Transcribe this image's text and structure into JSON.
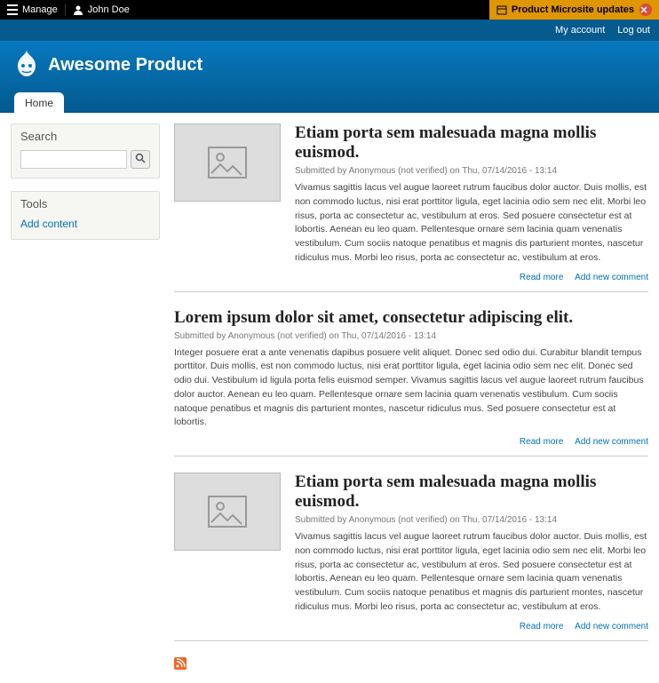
{
  "toolbar": {
    "manage_label": "Manage",
    "user_label": "John Doe",
    "updates_label": "Product Microsite updates"
  },
  "userbar": {
    "account": "My account",
    "logout": "Log out"
  },
  "site": {
    "name": "Awesome Product",
    "tabs": [
      "Home"
    ]
  },
  "sidebar": {
    "search_title": "Search",
    "search_placeholder": "",
    "tools_title": "Tools",
    "tools_links": [
      "Add content"
    ]
  },
  "links": {
    "read_more": "Read more",
    "add_comment": "Add new comment"
  },
  "articles": [
    {
      "has_image": true,
      "title": "Etiam porta sem malesuada magna mollis euismod.",
      "submitted": "Submitted by Anonymous (not verified) on Thu, 07/14/2016 - 13:14",
      "teaser": "Vivamus sagittis lacus vel augue laoreet rutrum faucibus dolor auctor. Duis mollis, est non commodo luctus, nisi erat porttitor ligula, eget lacinia odio sem nec elit. Morbi leo risus, porta ac consectetur ac, vestibulum at eros. Sed posuere consectetur est at lobortis. Aenean eu leo quam. Pellentesque ornare sem lacinia quam venenatis vestibulum. Cum sociis natoque penatibus et magnis dis parturient montes, nascetur ridiculus mus. Morbi leo risus, porta ac consectetur ac, vestibulum at eros."
    },
    {
      "has_image": false,
      "title": "Lorem ipsum dolor sit amet, consectetur adipiscing elit.",
      "submitted": "Submitted by Anonymous (not verified) on Thu, 07/14/2016 - 13:14",
      "teaser": "Integer posuere erat a ante venenatis dapibus posuere velit aliquet. Donec sed odio dui. Curabitur blandit tempus porttitor. Duis mollis, est non commodo luctus, nisi erat porttitor ligula, eget lacinia odio sem nec elit. Donec sed odio dui. Vestibulum id ligula porta felis euismod semper. Vivamus sagittis lacus vel augue laoreet rutrum faucibus dolor auctor. Aenean eu leo quam. Pellentesque ornare sem lacinia quam venenatis vestibulum. Cum sociis natoque penatibus et magnis dis parturient montes, nascetur ridiculus mus. Sed posuere consectetur est at lobortis."
    },
    {
      "has_image": true,
      "title": "Etiam porta sem malesuada magna mollis euismod.",
      "submitted": "Submitted by Anonymous (not verified) on Thu, 07/14/2016 - 13:14",
      "teaser": "Vivamus sagittis lacus vel augue laoreet rutrum faucibus dolor auctor. Duis mollis, est non commodo luctus, nisi erat porttitor ligula, eget lacinia odio sem nec elit. Morbi leo risus, porta ac consectetur ac, vestibulum at eros. Sed posuere consectetur est at lobortis. Aenean eu leo quam. Pellentesque ornare sem lacinia quam venenatis vestibulum. Cum sociis natoque penatibus et magnis dis parturient montes, nascetur ridiculus mus. Morbi leo risus, porta ac consectetur ac, vestibulum at eros."
    }
  ]
}
